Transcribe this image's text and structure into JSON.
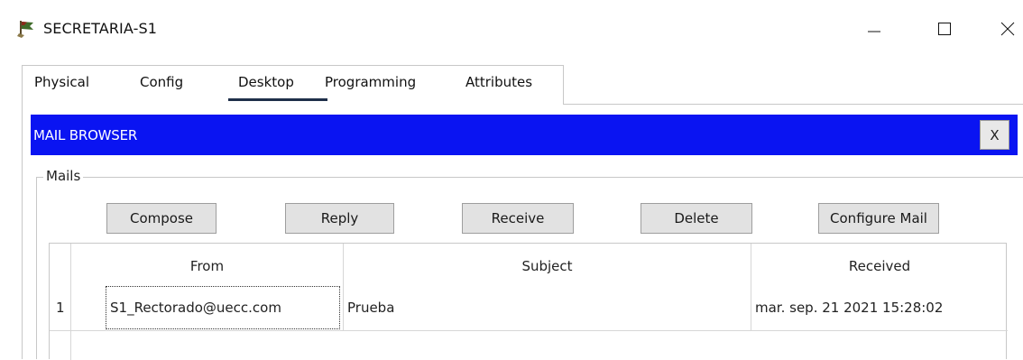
{
  "window": {
    "title": "SECRETARIA-S1",
    "icon": "pc-flag-icon",
    "controls": {
      "minimize": "–",
      "maximize": "☐",
      "close": "✕"
    }
  },
  "tabs": [
    {
      "label": "Physical",
      "active": false
    },
    {
      "label": "Config",
      "active": false
    },
    {
      "label": "Desktop",
      "active": true
    },
    {
      "label": "Programming",
      "active": false
    },
    {
      "label": "Attributes",
      "active": false
    }
  ],
  "mail_browser": {
    "title": "MAIL BROWSER",
    "close_label": "X",
    "header_color": "#0a14f2",
    "group_label": "Mails",
    "buttons": {
      "compose": "Compose",
      "reply": "Reply",
      "receive": "Receive",
      "delete": "Delete",
      "configure": "Configure Mail"
    },
    "table": {
      "columns": {
        "from": "From",
        "subject": "Subject",
        "received": "Received"
      },
      "rows": [
        {
          "num": "1",
          "from": "S1_Rectorado@uecc.com",
          "subject": "Prueba",
          "received": "mar. sep. 21 2021 15:28:02"
        }
      ]
    }
  }
}
